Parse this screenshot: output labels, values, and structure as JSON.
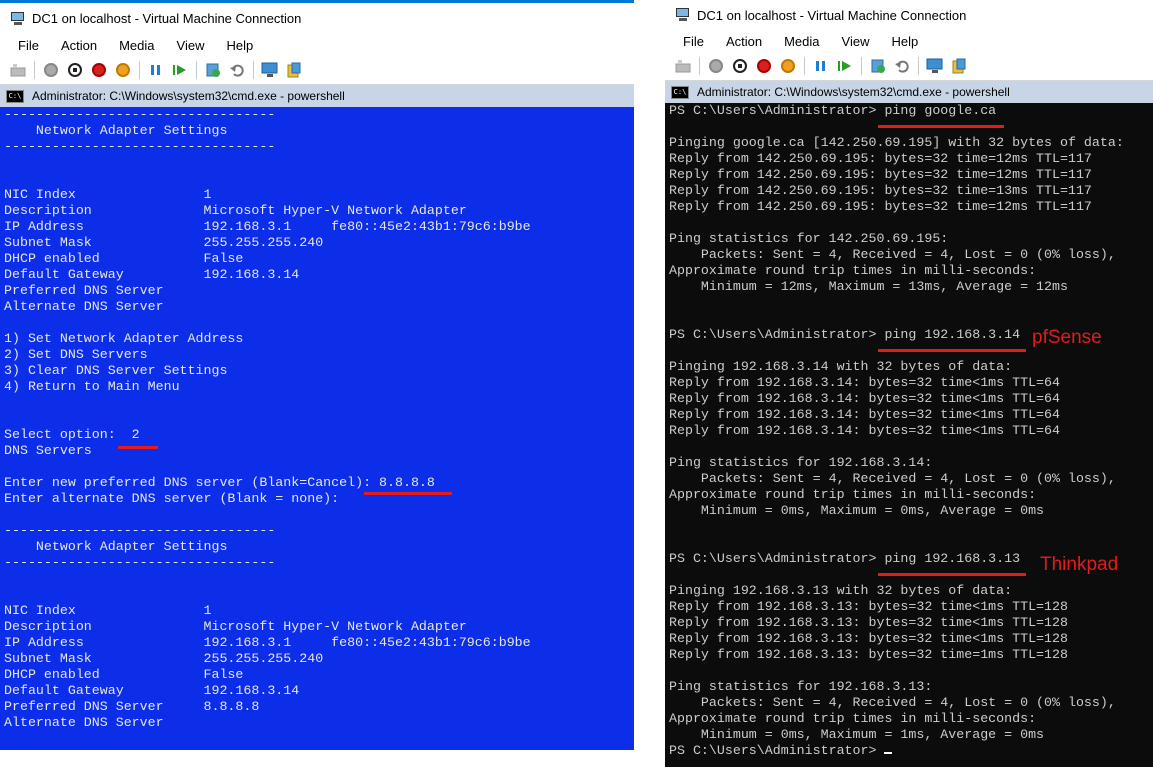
{
  "left": {
    "window_title": "DC1 on localhost - Virtual Machine Connection",
    "menu": [
      "File",
      "Action",
      "Media",
      "View",
      "Help"
    ],
    "cmd_title": "Administrator: C:\\Windows\\system32\\cmd.exe - powershell",
    "console_lines": [
      "----------------------------------",
      "    Network Adapter Settings",
      "----------------------------------",
      "",
      "",
      "NIC Index                1",
      "Description              Microsoft Hyper-V Network Adapter",
      "IP Address               192.168.3.1     fe80::45e2:43b1:79c6:b9be",
      "Subnet Mask              255.255.255.240",
      "DHCP enabled             False",
      "Default Gateway          192.168.3.14",
      "Preferred DNS Server",
      "Alternate DNS Server",
      "",
      "1) Set Network Adapter Address",
      "2) Set DNS Servers",
      "3) Clear DNS Server Settings",
      "4) Return to Main Menu",
      "",
      "",
      "Select option:  2",
      "DNS Servers",
      "",
      "Enter new preferred DNS server (Blank=Cancel): 8.8.8.8",
      "Enter alternate DNS server (Blank = none):",
      "",
      "----------------------------------",
      "    Network Adapter Settings",
      "----------------------------------",
      "",
      "",
      "NIC Index                1",
      "Description              Microsoft Hyper-V Network Adapter",
      "IP Address               192.168.3.1     fe80::45e2:43b1:79c6:b9be",
      "Subnet Mask              255.255.255.240",
      "DHCP enabled             False",
      "Default Gateway          192.168.3.14",
      "Preferred DNS Server     8.8.8.8",
      "Alternate DNS Server"
    ]
  },
  "right": {
    "window_title": "DC1 on localhost - Virtual Machine Connection",
    "menu": [
      "File",
      "Action",
      "Media",
      "View",
      "Help"
    ],
    "cmd_title": "Administrator: C:\\Windows\\system32\\cmd.exe - powershell",
    "console_lines": [
      "PS C:\\Users\\Administrator> ping google.ca",
      "",
      "Pinging google.ca [142.250.69.195] with 32 bytes of data:",
      "Reply from 142.250.69.195: bytes=32 time=12ms TTL=117",
      "Reply from 142.250.69.195: bytes=32 time=12ms TTL=117",
      "Reply from 142.250.69.195: bytes=32 time=13ms TTL=117",
      "Reply from 142.250.69.195: bytes=32 time=12ms TTL=117",
      "",
      "Ping statistics for 142.250.69.195:",
      "    Packets: Sent = 4, Received = 4, Lost = 0 (0% loss),",
      "Approximate round trip times in milli-seconds:",
      "    Minimum = 12ms, Maximum = 13ms, Average = 12ms",
      "",
      "",
      "PS C:\\Users\\Administrator> ping 192.168.3.14",
      "",
      "Pinging 192.168.3.14 with 32 bytes of data:",
      "Reply from 192.168.3.14: bytes=32 time<1ms TTL=64",
      "Reply from 192.168.3.14: bytes=32 time<1ms TTL=64",
      "Reply from 192.168.3.14: bytes=32 time<1ms TTL=64",
      "Reply from 192.168.3.14: bytes=32 time<1ms TTL=64",
      "",
      "Ping statistics for 192.168.3.14:",
      "    Packets: Sent = 4, Received = 4, Lost = 0 (0% loss),",
      "Approximate round trip times in milli-seconds:",
      "    Minimum = 0ms, Maximum = 0ms, Average = 0ms",
      "",
      "",
      "PS C:\\Users\\Administrator> ping 192.168.3.13",
      "",
      "Pinging 192.168.3.13 with 32 bytes of data:",
      "Reply from 192.168.3.13: bytes=32 time<1ms TTL=128",
      "Reply from 192.168.3.13: bytes=32 time<1ms TTL=128",
      "Reply from 192.168.3.13: bytes=32 time<1ms TTL=128",
      "Reply from 192.168.3.13: bytes=32 time=1ms TTL=128",
      "",
      "Ping statistics for 192.168.3.13:",
      "    Packets: Sent = 4, Received = 4, Lost = 0 (0% loss),",
      "Approximate round trip times in milli-seconds:",
      "    Minimum = 0ms, Maximum = 1ms, Average = 0ms"
    ],
    "prompt": "PS C:\\Users\\Administrator> ",
    "annotations": {
      "pfsense": "pfSense",
      "thinkpad": "Thinkpad"
    }
  },
  "colors": {
    "left_console_bg": "#0c2ee8",
    "right_console_bg": "#0c0c0c",
    "annotation_red": "#e31b1b"
  },
  "icons": [
    "vm-icon",
    "ctrl-alt-del-icon",
    "start-icon",
    "turn-off-icon",
    "shutdown-icon",
    "save-icon",
    "pause-icon",
    "resume-icon",
    "checkpoint-icon",
    "revert-icon",
    "enhanced-session-icon",
    "share-icon"
  ]
}
